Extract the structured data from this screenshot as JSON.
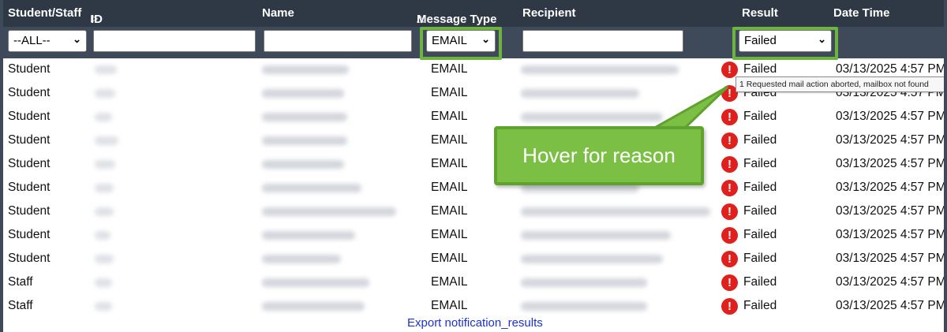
{
  "columns": {
    "student_staff": "Student/Staff",
    "id": "ID",
    "name": "Name",
    "sort_icon": "△",
    "message_type": "Message Type",
    "recipient": "Recipient",
    "result": "Result",
    "date_time": "Date Time"
  },
  "filters": {
    "student_staff": "--ALL--",
    "id": "",
    "name": "",
    "message_type": "EMAIL",
    "recipient": "",
    "result": "Failed"
  },
  "rows": [
    {
      "type": "Student",
      "message_type": "EMAIL",
      "result": "Failed",
      "date_time": "03/13/2025 4:57 PM"
    },
    {
      "type": "Student",
      "message_type": "EMAIL",
      "result": "Failed",
      "date_time": "03/13/2025 4:57 PM"
    },
    {
      "type": "Student",
      "message_type": "EMAIL",
      "result": "Failed",
      "date_time": "03/13/2025 4:57 PM"
    },
    {
      "type": "Student",
      "message_type": "EMAIL",
      "result": "Failed",
      "date_time": "03/13/2025 4:57 PM"
    },
    {
      "type": "Student",
      "message_type": "EMAIL",
      "result": "Failed",
      "date_time": "03/13/2025 4:57 PM"
    },
    {
      "type": "Student",
      "message_type": "EMAIL",
      "result": "Failed",
      "date_time": "03/13/2025 4:57 PM"
    },
    {
      "type": "Student",
      "message_type": "EMAIL",
      "result": "Failed",
      "date_time": "03/13/2025 4:57 PM"
    },
    {
      "type": "Student",
      "message_type": "EMAIL",
      "result": "Failed",
      "date_time": "03/13/2025 4:57 PM"
    },
    {
      "type": "Student",
      "message_type": "EMAIL",
      "result": "Failed",
      "date_time": "03/13/2025 4:57 PM"
    },
    {
      "type": "Staff",
      "message_type": "EMAIL",
      "result": "Failed",
      "date_time": "03/13/2025 4:57 PM"
    },
    {
      "type": "Staff",
      "message_type": "EMAIL",
      "result": "Failed",
      "date_time": "03/13/2025 4:57 PM"
    }
  ],
  "error_icon": {
    "name": "error-exclamation-icon",
    "glyph": "!",
    "color": "#e0201c"
  },
  "tooltip": "1 Requested mail action aborted, mailbox not found",
  "callout": "Hover for reason",
  "export_link": "Export notification_results",
  "colors": {
    "header_bg": "#2f3845",
    "filter_bg": "#3e4a5a",
    "highlight": "#6db33f",
    "link": "#1a33c9"
  }
}
